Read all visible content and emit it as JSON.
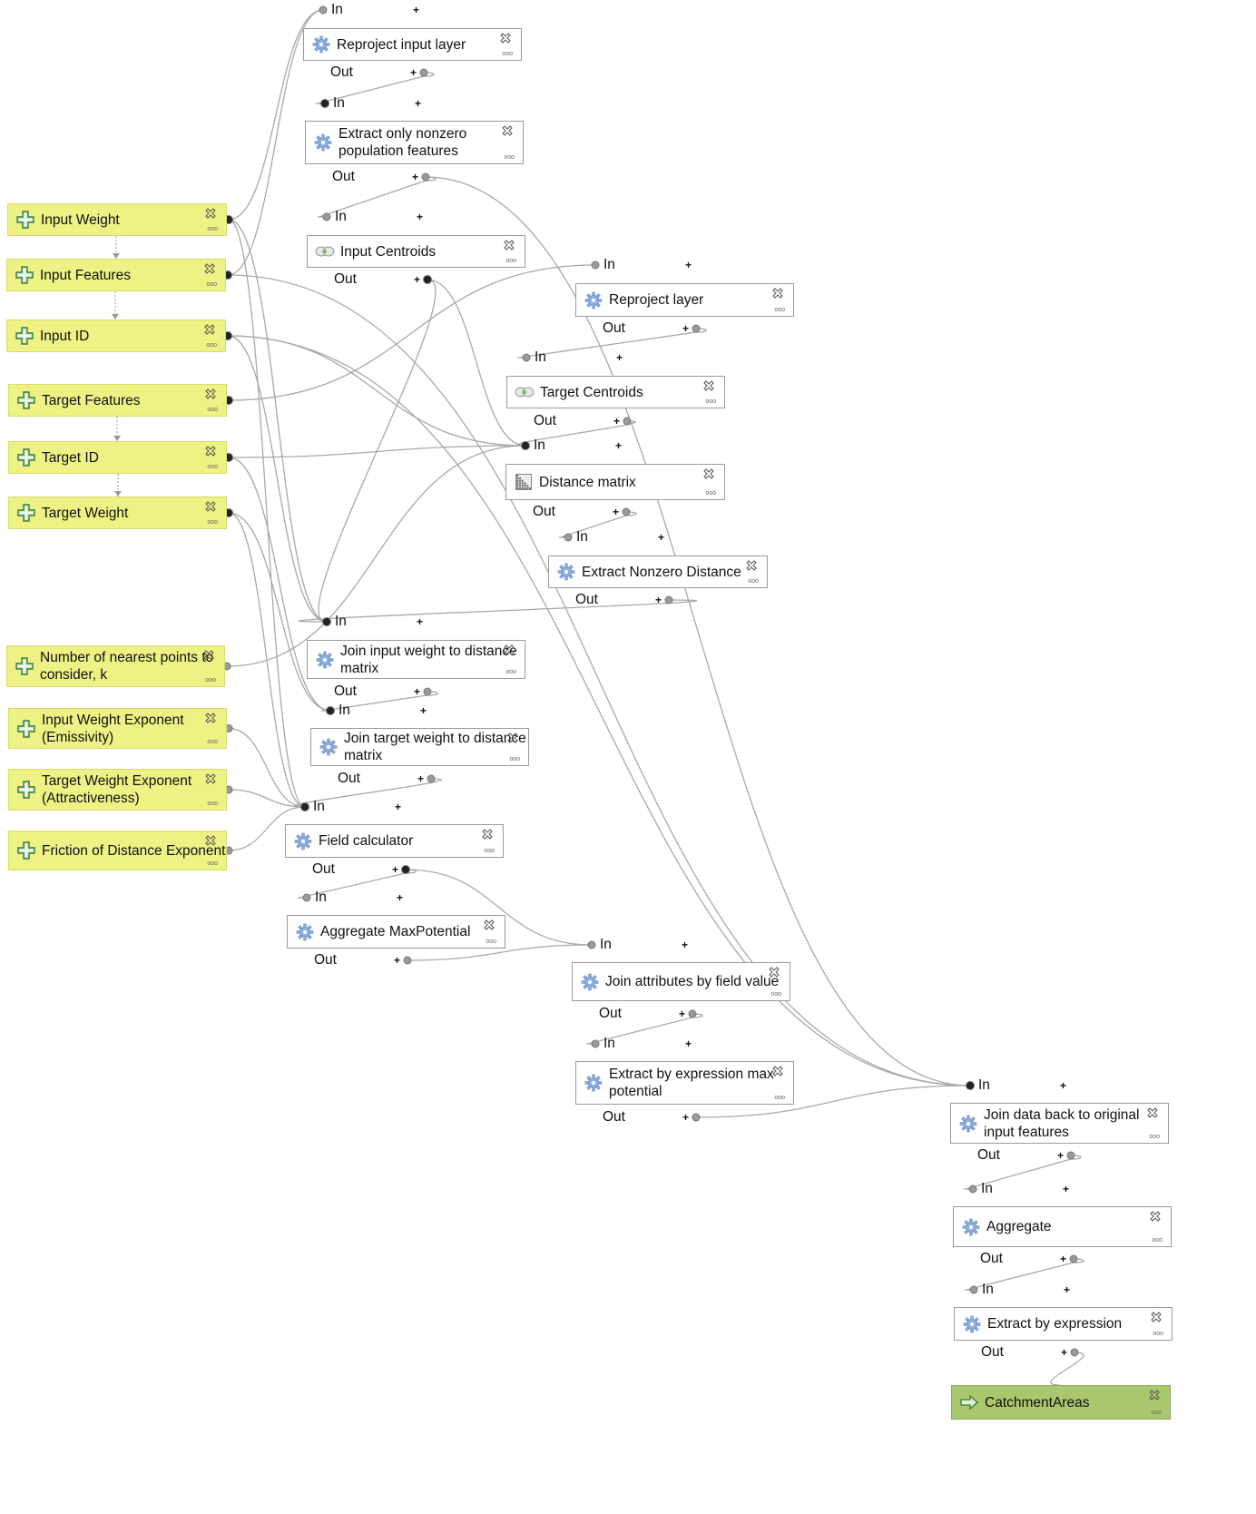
{
  "inputs": [
    {
      "label": "Input Weight"
    },
    {
      "label": "Input Features"
    },
    {
      "label": "Input ID"
    },
    {
      "label": "Target Features"
    },
    {
      "label": "Target ID"
    },
    {
      "label": "Target Weight"
    },
    {
      "label": "Number of nearest points to consider, k"
    },
    {
      "label": "Input Weight Exponent (Emissivity)"
    },
    {
      "label": "Target Weight Exponent (Attractiveness)"
    },
    {
      "label": "Friction of Distance Exponent"
    }
  ],
  "algorithms": [
    {
      "label": "Reproject input layer",
      "icon": "gear-icon"
    },
    {
      "label": "Extract only nonzero population features",
      "icon": "gear-icon"
    },
    {
      "label": "Input Centroids",
      "icon": "centroid-icon"
    },
    {
      "label": "Reproject layer",
      "icon": "gear-icon"
    },
    {
      "label": "Target Centroids",
      "icon": "centroid-icon"
    },
    {
      "label": "Distance matrix",
      "icon": "matrix-icon"
    },
    {
      "label": "Extract Nonzero Distance",
      "icon": "gear-icon"
    },
    {
      "label": "Join input weight to distance matrix",
      "icon": "gear-icon"
    },
    {
      "label": "Join target weight to distance matrix",
      "icon": "gear-icon"
    },
    {
      "label": "Field calculator",
      "icon": "gear-icon"
    },
    {
      "label": "Aggregate MaxPotential",
      "icon": "gear-icon"
    },
    {
      "label": "Join attributes by field value",
      "icon": "gear-icon"
    },
    {
      "label": "Extract by expression max potential",
      "icon": "gear-icon"
    },
    {
      "label": "Join data back to original input features",
      "icon": "gear-icon"
    },
    {
      "label": "Aggregate",
      "icon": "gear-icon"
    },
    {
      "label": "Extract by expression",
      "icon": "gear-icon"
    }
  ],
  "outputs": [
    {
      "label": "CatchmentAreas"
    }
  ],
  "ports": {
    "in": "In",
    "out": "Out",
    "add": "+"
  },
  "colors": {
    "input_fill": "#eef184",
    "output_fill": "#a9c76d",
    "wire": "#a8a8a8"
  }
}
